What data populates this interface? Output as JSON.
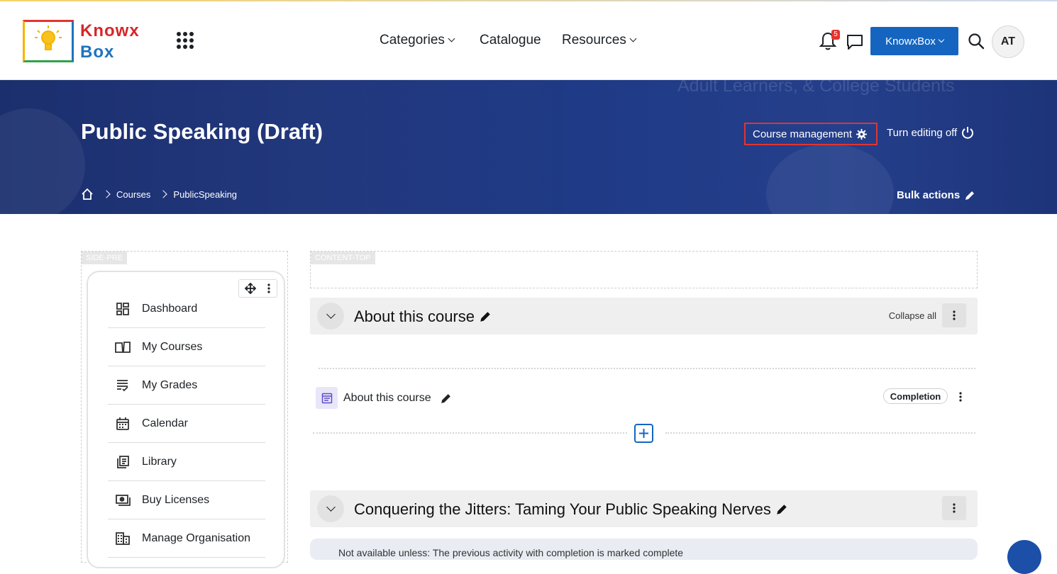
{
  "brand": {
    "line1": "Knowx",
    "line2": "Box"
  },
  "nav": {
    "categories": "Categories",
    "catalogue": "Catalogue",
    "resources": "Resources",
    "notification_count": "5",
    "account_button": "KnowxBox",
    "avatar_initials": "AT"
  },
  "hero": {
    "background_text": "Adult Learners, & College Students",
    "title": "Public Speaking (Draft)",
    "course_management": "Course management",
    "turn_editing_off": "Turn editing off",
    "bulk_actions": "Bulk actions",
    "breadcrumb": [
      "Courses",
      "PublicSpeaking"
    ]
  },
  "sidebar": {
    "region_label": "SIDE-PRE",
    "items": [
      {
        "label": "Dashboard",
        "icon": "dashboard-icon"
      },
      {
        "label": "My Courses",
        "icon": "book-open-icon"
      },
      {
        "label": "My Grades",
        "icon": "grades-list-icon"
      },
      {
        "label": "Calendar",
        "icon": "calendar-icon"
      },
      {
        "label": "Library",
        "icon": "library-icon"
      },
      {
        "label": "Buy Licenses",
        "icon": "license-icon"
      },
      {
        "label": "Manage Organisation",
        "icon": "organisation-icon"
      }
    ]
  },
  "content": {
    "region_label": "CONTENT-TOP",
    "section1": {
      "title": "About this course",
      "collapse_all": "Collapse all",
      "activity_name": "About this course",
      "completion": "Completion"
    },
    "section2": {
      "title": "Conquering the Jitters: Taming Your Public Speaking Nerves",
      "restriction": "Not available unless: The previous activity with completion is marked complete"
    }
  },
  "colors": {
    "primary": "#1565c0",
    "hero_bg": "#22387d",
    "highlight_border": "#e3342f"
  }
}
